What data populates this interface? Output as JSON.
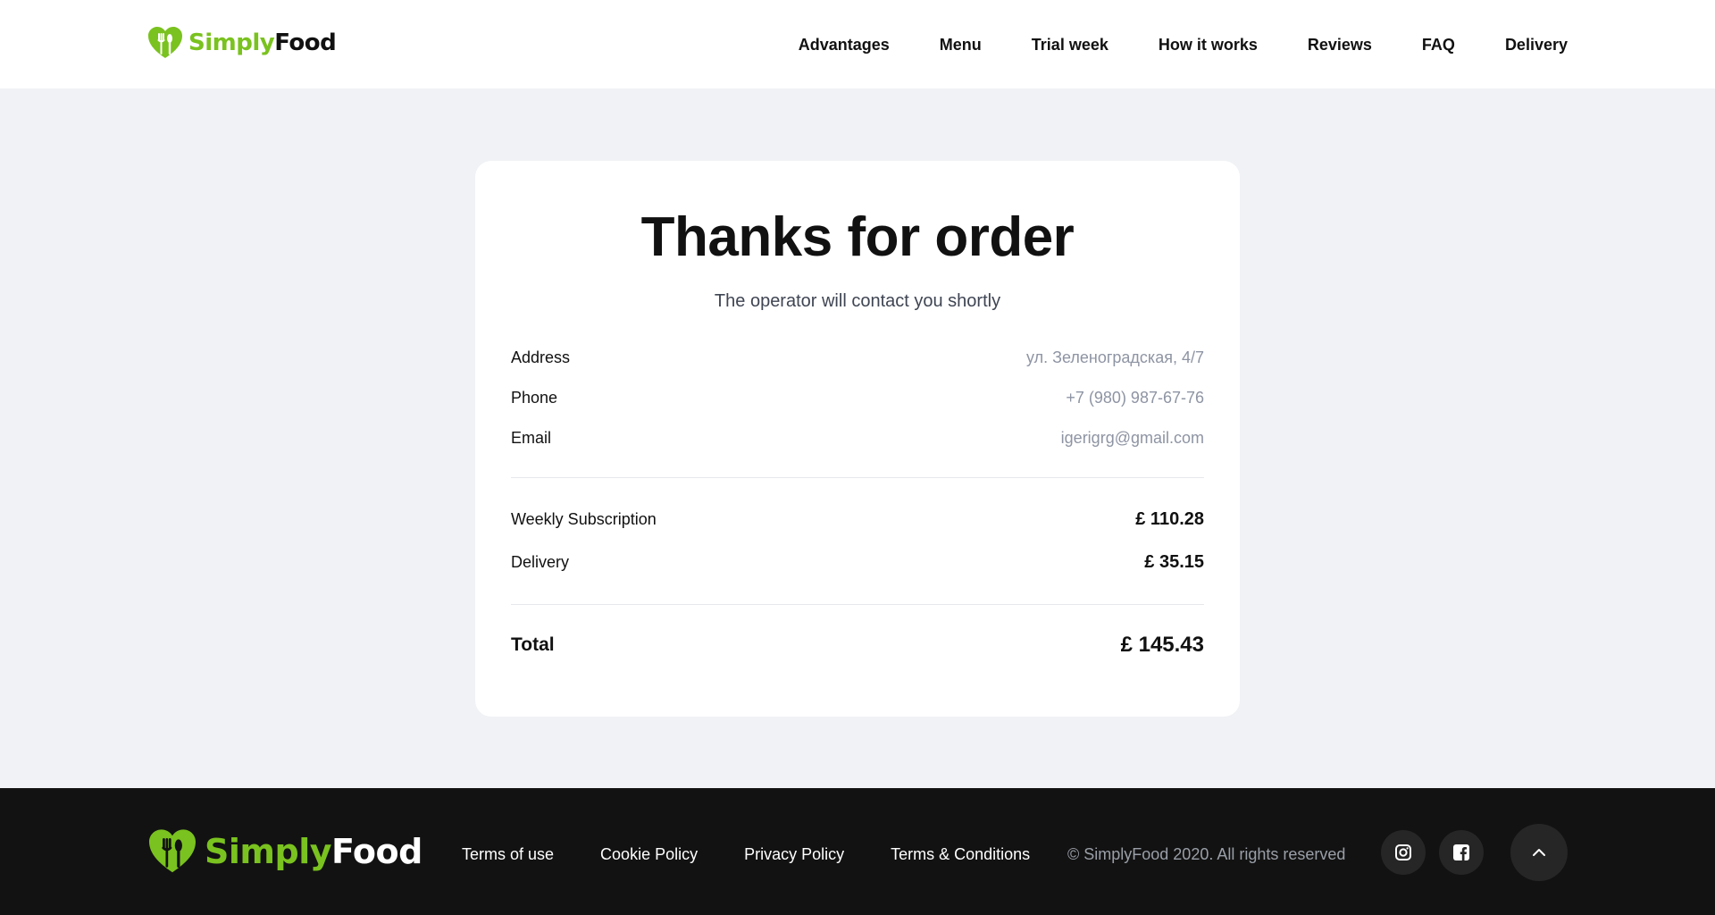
{
  "brand": {
    "name_part1": "Simply",
    "name_part2": "Food",
    "accent_color": "#7ac21f"
  },
  "nav": {
    "items": [
      {
        "label": "Advantages"
      },
      {
        "label": "Menu"
      },
      {
        "label": "Trial week"
      },
      {
        "label": "How it works"
      },
      {
        "label": "Reviews"
      },
      {
        "label": "FAQ"
      },
      {
        "label": "Delivery"
      }
    ]
  },
  "order": {
    "title": "Thanks for order",
    "subtitle": "The operator will contact you shortly",
    "contact": {
      "address_label": "Address",
      "address_value": "ул. Зеленоградская, 4/7",
      "phone_label": "Phone",
      "phone_value": "+7 (980) 987-67-76",
      "email_label": "Email",
      "email_value": "igerigrg@gmail.com"
    },
    "lines": [
      {
        "label": "Weekly Subscription",
        "price": "£ 110.28"
      },
      {
        "label": "Delivery",
        "price": "£ 35.15"
      }
    ],
    "total": {
      "label": "Total",
      "price": "£ 145.43"
    }
  },
  "footer": {
    "links": [
      {
        "label": "Terms of use"
      },
      {
        "label": "Cookie Policy"
      },
      {
        "label": "Privacy Policy"
      },
      {
        "label": "Terms & Conditions"
      }
    ],
    "copyright": "© SimplyFood 2020. All rights reserved",
    "social": [
      {
        "icon": "instagram-icon"
      },
      {
        "icon": "facebook-icon"
      }
    ],
    "scroll_top_icon": "chevron-up-icon"
  }
}
